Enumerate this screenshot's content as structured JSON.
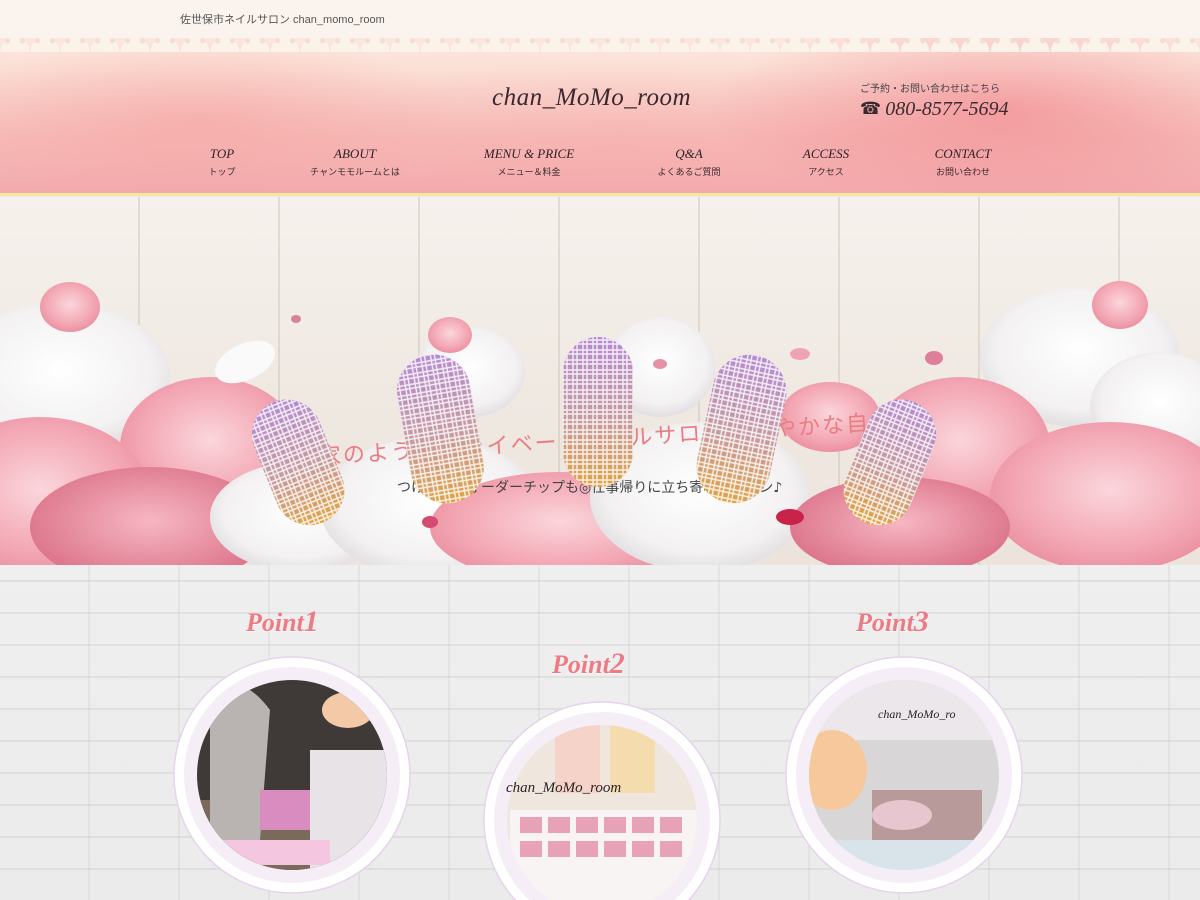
{
  "header": {
    "tagline": "佐世保市ネイルサロン chan_momo_room",
    "logo": "chan_MoMo_room",
    "contact_caption": "ご予約・お問い合わせはこちら",
    "phone_icon": "☎",
    "phone": "080-8577-5694"
  },
  "nav": [
    {
      "en": "TOP",
      "jp": "トップ"
    },
    {
      "en": "ABOUT",
      "jp": "チャンモモルームとは"
    },
    {
      "en": "MENU & PRICE",
      "jp": "メニュー＆料金"
    },
    {
      "en": "Q&A",
      "jp": "よくあるご質問"
    },
    {
      "en": "ACCESS",
      "jp": "アクセス"
    },
    {
      "en": "CONTACT",
      "jp": "お問い合わせ"
    }
  ],
  "hero": {
    "title": "隠れ家のようなプライベートネイルサロンで華やかな自分に♪",
    "subtitle": "つけ放題・オーダーチップも◎仕事帰りに立ち寄れるサロン♪"
  },
  "points": [
    {
      "label": "Point",
      "num": "1",
      "caption": ""
    },
    {
      "label": "Point",
      "num": "2",
      "caption": "chan_MoMo_room"
    },
    {
      "label": "Point",
      "num": "3",
      "caption": "chan_MoMo_ro"
    }
  ],
  "colors": {
    "accent_pink": "#ee7b84",
    "header_rule": "#f3e7a2",
    "text_dark": "#2e2226"
  }
}
